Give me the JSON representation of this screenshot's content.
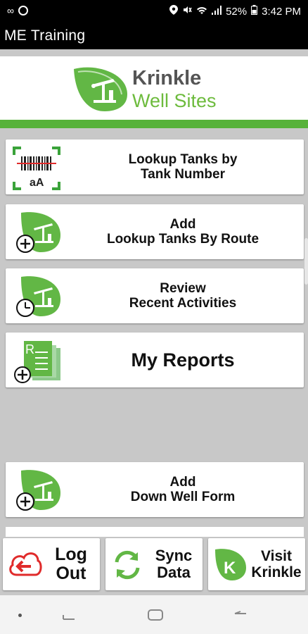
{
  "status_bar": {
    "battery": "52%",
    "time": "3:42 PM"
  },
  "app": {
    "title": "ME  Training"
  },
  "logo": {
    "name": "Krinkle",
    "tagline": "Well Sites"
  },
  "menu": {
    "lookup_tanks_number": {
      "line1": "Lookup Tanks by",
      "line2": "Tank Number",
      "barcode_text": "aA"
    },
    "lookup_tanks_route": {
      "line1": "Add",
      "line2": "Lookup Tanks By Route"
    },
    "recent_activities": {
      "line1": "Review",
      "line2": "Recent Activities"
    },
    "my_reports": {
      "label": "My Reports",
      "report_letter": "R"
    },
    "down_well_form": {
      "line1": "Add",
      "line2": "Down Well Form"
    }
  },
  "bottom": {
    "logout": {
      "line1": "Log",
      "line2": "Out"
    },
    "sync": {
      "line1": "Sync",
      "line2": "Data"
    },
    "visit": {
      "line1": "Visit",
      "line2": "Krinkle",
      "badge": "K"
    }
  },
  "colors": {
    "brand_green": "#57b23a",
    "logout_red": "#e02b2b"
  }
}
